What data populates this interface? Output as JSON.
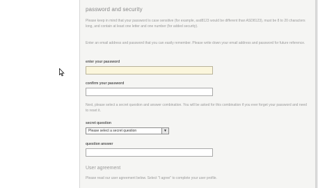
{
  "section": {
    "title": "password and security",
    "intro": "Please keep in mind that your password is case sensitive (for example, asd8123 would be different than ASD8123), must be 8 to 20 characters long, and contain at least one letter and one number (for added security).",
    "remember": "Enter an email address and password that you can easily remember. Please write down your email address and password for future reference."
  },
  "form": {
    "password_label": "enter your password",
    "confirm_label": "confirm your password",
    "question_help": "Next, please select a secret question and answer combination. You will be asked for this combination if you ever forget your password and need to reset it.",
    "secret_question_label": "secret question",
    "secret_question_value": "Please select a secret question",
    "answer_label": "question answer"
  },
  "agreement": {
    "title": "User agreement",
    "text": "Please read our user agreement below. Select \"I agree\" to complete your user profile."
  },
  "icons": {
    "cursor": "arrow-cursor-icon",
    "dropdown": "chevron-down-icon"
  },
  "colors": {
    "highlight_field": "#fbf6dc",
    "panel": "#f5f5f3"
  }
}
